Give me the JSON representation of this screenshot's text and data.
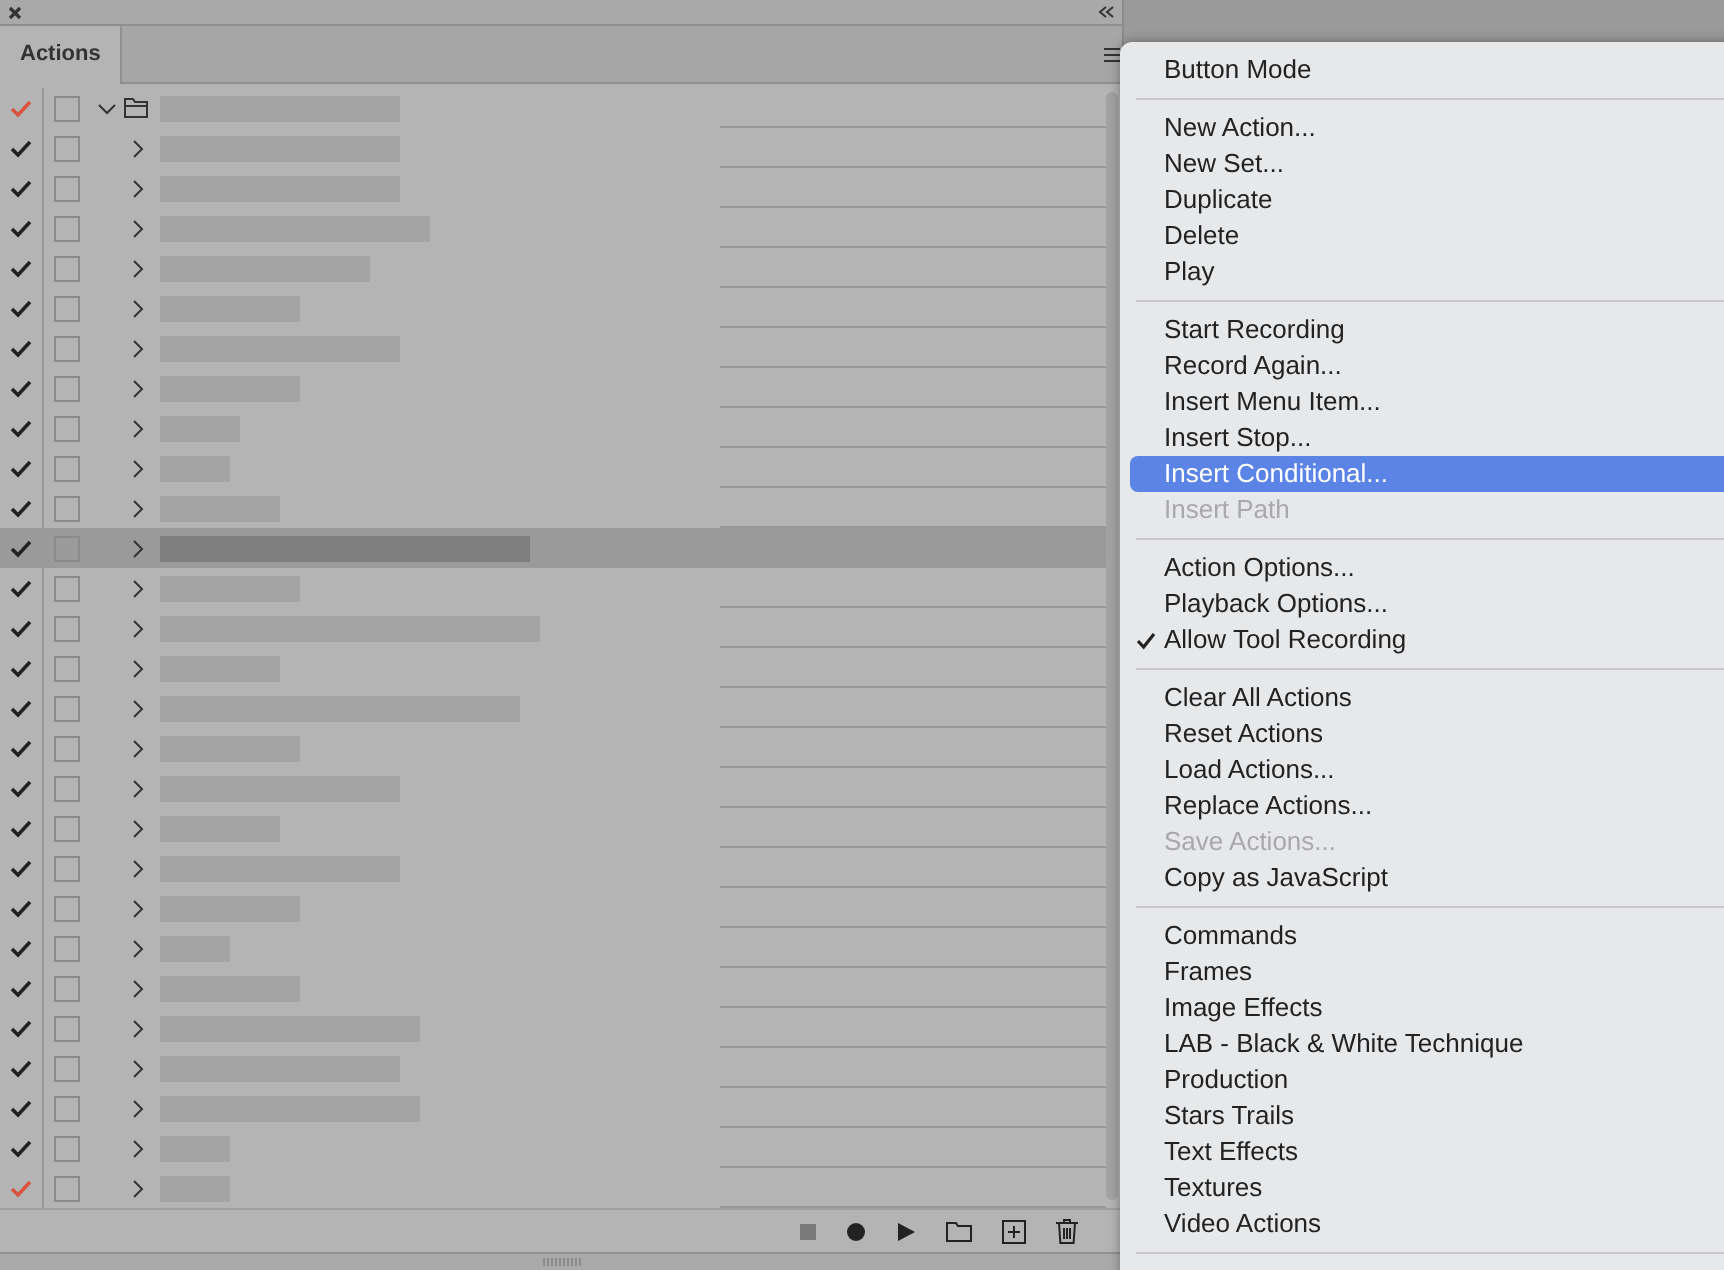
{
  "panel": {
    "tabs": [
      {
        "label": "Actions",
        "selected": true
      }
    ],
    "rows": [
      {
        "kind": "set",
        "enabled": true,
        "partial": true,
        "dialog": false,
        "expanded": true,
        "selected": false
      },
      {
        "kind": "action",
        "enabled": true,
        "partial": false,
        "dialog": false,
        "expanded": false,
        "selected": false
      },
      {
        "kind": "action",
        "enabled": true,
        "partial": false,
        "dialog": false,
        "expanded": false,
        "selected": false
      },
      {
        "kind": "action",
        "enabled": true,
        "partial": false,
        "dialog": false,
        "expanded": false,
        "selected": false
      },
      {
        "kind": "action",
        "enabled": true,
        "partial": false,
        "dialog": false,
        "expanded": false,
        "selected": false
      },
      {
        "kind": "action",
        "enabled": true,
        "partial": false,
        "dialog": false,
        "expanded": false,
        "selected": false
      },
      {
        "kind": "action",
        "enabled": true,
        "partial": false,
        "dialog": false,
        "expanded": false,
        "selected": false
      },
      {
        "kind": "action",
        "enabled": true,
        "partial": false,
        "dialog": false,
        "expanded": false,
        "selected": false
      },
      {
        "kind": "action",
        "enabled": true,
        "partial": false,
        "dialog": false,
        "expanded": false,
        "selected": false
      },
      {
        "kind": "action",
        "enabled": true,
        "partial": false,
        "dialog": false,
        "expanded": false,
        "selected": false
      },
      {
        "kind": "action",
        "enabled": true,
        "partial": false,
        "dialog": false,
        "expanded": false,
        "selected": false
      },
      {
        "kind": "action",
        "enabled": true,
        "partial": false,
        "dialog": false,
        "expanded": false,
        "selected": true
      },
      {
        "kind": "action",
        "enabled": true,
        "partial": false,
        "dialog": false,
        "expanded": false,
        "selected": false
      },
      {
        "kind": "action",
        "enabled": true,
        "partial": false,
        "dialog": false,
        "expanded": false,
        "selected": false
      },
      {
        "kind": "action",
        "enabled": true,
        "partial": false,
        "dialog": false,
        "expanded": false,
        "selected": false
      },
      {
        "kind": "action",
        "enabled": true,
        "partial": false,
        "dialog": false,
        "expanded": false,
        "selected": false
      },
      {
        "kind": "action",
        "enabled": true,
        "partial": false,
        "dialog": false,
        "expanded": false,
        "selected": false
      },
      {
        "kind": "action",
        "enabled": true,
        "partial": false,
        "dialog": false,
        "expanded": false,
        "selected": false
      },
      {
        "kind": "action",
        "enabled": true,
        "partial": false,
        "dialog": false,
        "expanded": false,
        "selected": false
      },
      {
        "kind": "action",
        "enabled": true,
        "partial": false,
        "dialog": false,
        "expanded": false,
        "selected": false
      },
      {
        "kind": "action",
        "enabled": true,
        "partial": false,
        "dialog": false,
        "expanded": false,
        "selected": false
      },
      {
        "kind": "action",
        "enabled": true,
        "partial": false,
        "dialog": false,
        "expanded": false,
        "selected": false
      },
      {
        "kind": "action",
        "enabled": true,
        "partial": false,
        "dialog": false,
        "expanded": false,
        "selected": false
      },
      {
        "kind": "action",
        "enabled": true,
        "partial": false,
        "dialog": false,
        "expanded": false,
        "selected": false
      },
      {
        "kind": "action",
        "enabled": true,
        "partial": false,
        "dialog": false,
        "expanded": false,
        "selected": false
      },
      {
        "kind": "action",
        "enabled": true,
        "partial": false,
        "dialog": false,
        "expanded": false,
        "selected": false
      },
      {
        "kind": "action",
        "enabled": true,
        "partial": false,
        "dialog": false,
        "expanded": false,
        "selected": false
      },
      {
        "kind": "action",
        "enabled": true,
        "partial": true,
        "dialog": false,
        "expanded": false,
        "selected": false
      }
    ]
  },
  "menu": {
    "sections": [
      {
        "items": [
          {
            "label": "Button Mode",
            "disabled": false,
            "checked": false,
            "selected": false
          }
        ]
      },
      {
        "items": [
          {
            "label": "New Action...",
            "disabled": false,
            "checked": false,
            "selected": false
          },
          {
            "label": "New Set...",
            "disabled": false,
            "checked": false,
            "selected": false
          },
          {
            "label": "Duplicate",
            "disabled": false,
            "checked": false,
            "selected": false
          },
          {
            "label": "Delete",
            "disabled": false,
            "checked": false,
            "selected": false
          },
          {
            "label": "Play",
            "disabled": false,
            "checked": false,
            "selected": false
          }
        ]
      },
      {
        "items": [
          {
            "label": "Start Recording",
            "disabled": false,
            "checked": false,
            "selected": false
          },
          {
            "label": "Record Again...",
            "disabled": false,
            "checked": false,
            "selected": false
          },
          {
            "label": "Insert Menu Item...",
            "disabled": false,
            "checked": false,
            "selected": false
          },
          {
            "label": "Insert Stop...",
            "disabled": false,
            "checked": false,
            "selected": false
          },
          {
            "label": "Insert Conditional...",
            "disabled": false,
            "checked": false,
            "selected": true
          },
          {
            "label": "Insert Path",
            "disabled": true,
            "checked": false,
            "selected": false
          }
        ]
      },
      {
        "items": [
          {
            "label": "Action Options...",
            "disabled": false,
            "checked": false,
            "selected": false
          },
          {
            "label": "Playback Options...",
            "disabled": false,
            "checked": false,
            "selected": false
          },
          {
            "label": "Allow Tool Recording",
            "disabled": false,
            "checked": true,
            "selected": false
          }
        ]
      },
      {
        "items": [
          {
            "label": "Clear All Actions",
            "disabled": false,
            "checked": false,
            "selected": false
          },
          {
            "label": "Reset Actions",
            "disabled": false,
            "checked": false,
            "selected": false
          },
          {
            "label": "Load Actions...",
            "disabled": false,
            "checked": false,
            "selected": false
          },
          {
            "label": "Replace Actions...",
            "disabled": false,
            "checked": false,
            "selected": false
          },
          {
            "label": "Save Actions...",
            "disabled": true,
            "checked": false,
            "selected": false
          },
          {
            "label": "Copy as JavaScript",
            "disabled": false,
            "checked": false,
            "selected": false
          }
        ]
      },
      {
        "items": [
          {
            "label": "Commands",
            "disabled": false,
            "checked": false,
            "selected": false
          },
          {
            "label": "Frames",
            "disabled": false,
            "checked": false,
            "selected": false
          },
          {
            "label": "Image Effects",
            "disabled": false,
            "checked": false,
            "selected": false
          },
          {
            "label": "LAB - Black & White Technique",
            "disabled": false,
            "checked": false,
            "selected": false
          },
          {
            "label": "Production",
            "disabled": false,
            "checked": false,
            "selected": false
          },
          {
            "label": "Stars Trails",
            "disabled": false,
            "checked": false,
            "selected": false
          },
          {
            "label": "Text Effects",
            "disabled": false,
            "checked": false,
            "selected": false
          },
          {
            "label": "Textures",
            "disabled": false,
            "checked": false,
            "selected": false
          },
          {
            "label": "Video Actions",
            "disabled": false,
            "checked": false,
            "selected": false
          }
        ]
      }
    ]
  }
}
